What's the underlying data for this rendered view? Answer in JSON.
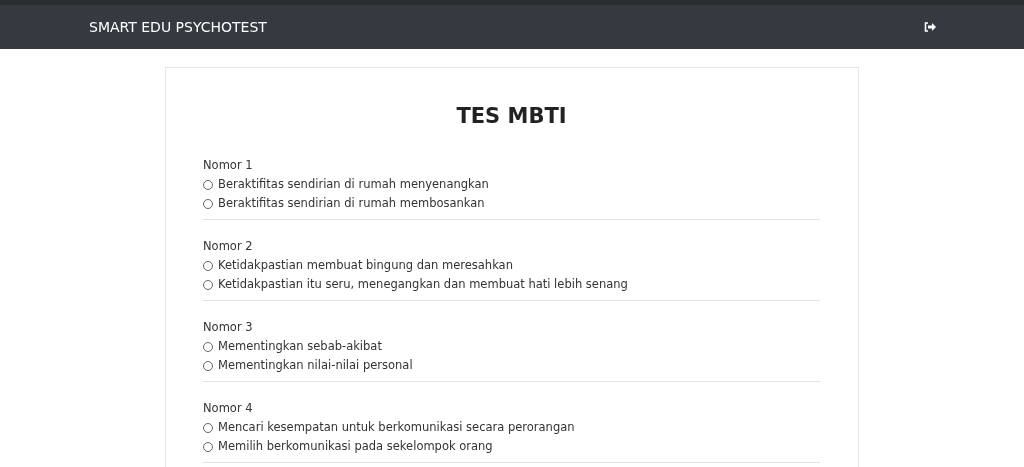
{
  "navbar": {
    "brand": "SMART EDU PSYCHOTEST"
  },
  "test": {
    "title": "TES MBTI",
    "questions": [
      {
        "label": "Nomor 1",
        "options": [
          {
            "text": "Beraktifitas sendirian di rumah menyenangkan",
            "selected": false
          },
          {
            "text": "Beraktifitas sendirian di rumah membosankan",
            "selected": false
          }
        ]
      },
      {
        "label": "Nomor 2",
        "options": [
          {
            "text": "Ketidakpastian membuat bingung dan meresahkan",
            "selected": false
          },
          {
            "text": "Ketidakpastian itu seru, menegangkan dan membuat hati lebih senang",
            "selected": false
          }
        ]
      },
      {
        "label": "Nomor 3",
        "options": [
          {
            "text": "Mementingkan sebab-akibat",
            "selected": false
          },
          {
            "text": "Mementingkan nilai-nilai personal",
            "selected": false
          }
        ]
      },
      {
        "label": "Nomor 4",
        "options": [
          {
            "text": "Mencari kesempatan untuk berkomunikasi secara perorangan",
            "selected": false
          },
          {
            "text": "Memilih berkomunikasi pada sekelompok orang",
            "selected": false
          }
        ]
      }
    ]
  }
}
